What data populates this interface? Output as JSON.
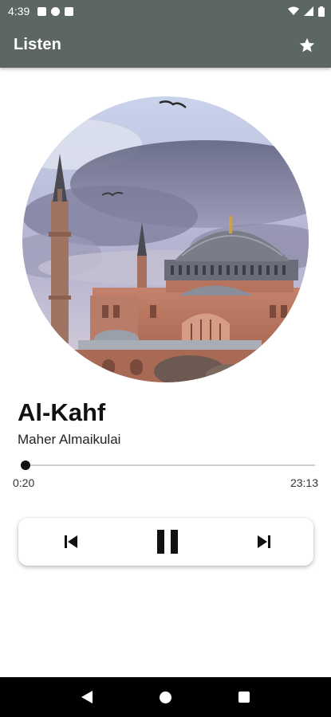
{
  "status_bar": {
    "time": "4:39"
  },
  "app_bar": {
    "title": "Listen",
    "favorite_icon": "star-icon"
  },
  "track": {
    "title": "Al-Kahf",
    "artist": "Maher Almaikulai"
  },
  "playback": {
    "current_time": "0:20",
    "total_time": "23:13",
    "progress": 0.014
  },
  "controls": {
    "previous_icon": "skip-previous-icon",
    "play_pause_icon": "pause-icon",
    "next_icon": "skip-next-icon"
  },
  "navigation": {
    "back_icon": "back-icon",
    "home_icon": "home-icon",
    "recents_icon": "recents-icon"
  },
  "colors": {
    "app_bar": "#5c6663",
    "nav_bar": "#000000",
    "accent": "#111111"
  }
}
